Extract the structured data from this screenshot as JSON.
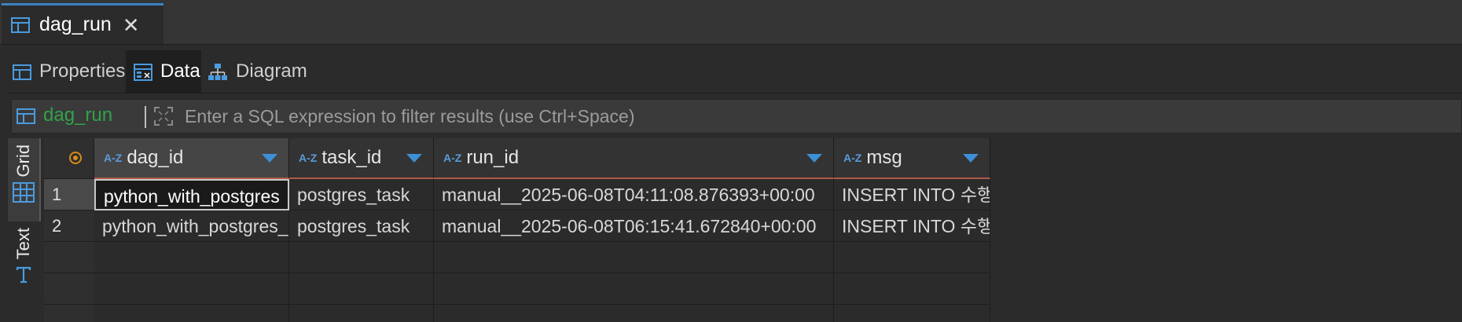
{
  "editor_tab": {
    "title": "dag_run",
    "close": "✕"
  },
  "sub_tabs": [
    {
      "label": "Properties",
      "icon": "table-icon"
    },
    {
      "label": "Data",
      "icon": "data-icon"
    },
    {
      "label": "Diagram",
      "icon": "diagram-icon"
    }
  ],
  "filter": {
    "table": "dag_run",
    "placeholder": "Enter a SQL expression to filter results (use Ctrl+Space)"
  },
  "side_tabs": {
    "grid": "Grid",
    "text": "Text"
  },
  "grid": {
    "type_prefix": "A-Z",
    "columns": [
      "dag_id",
      "task_id",
      "run_id",
      "msg"
    ],
    "rows": [
      {
        "num": "1",
        "cells": [
          "python_with_postgres",
          "postgres_task",
          "manual__2025-06-08T04:11:08.876393+00:00",
          "INSERT INTO 수행"
        ]
      },
      {
        "num": "2",
        "cells": [
          "python_with_postgres_",
          "postgres_task",
          "manual__2025-06-08T06:15:41.672840+00:00",
          "INSERT INTO 수행"
        ]
      }
    ]
  },
  "colors": {
    "accent": "#3d8fd6",
    "table_name": "#2fa34a",
    "header_underline": "#b05a4a"
  }
}
